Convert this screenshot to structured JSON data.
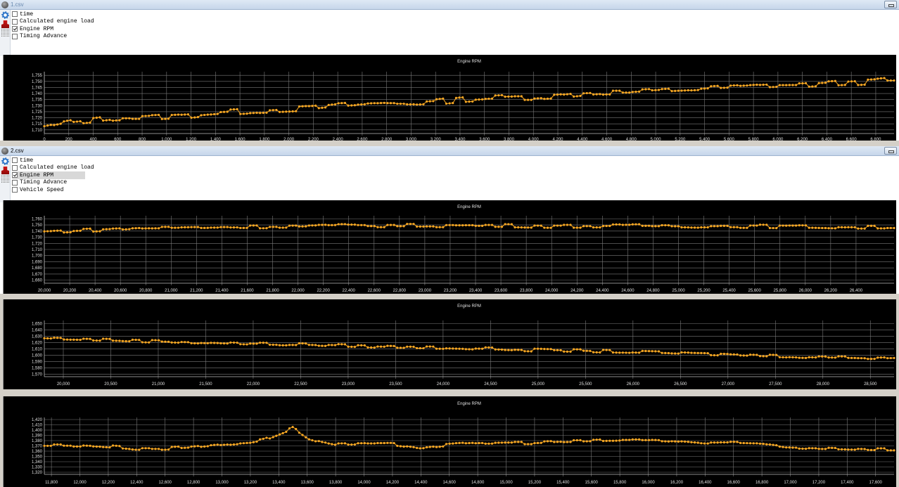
{
  "windows": [
    {
      "title": "1.csv",
      "fields": [
        {
          "label": "time",
          "checked": false
        },
        {
          "label": "Calculated engine load",
          "checked": false
        },
        {
          "label": "Engine RPM",
          "checked": true
        },
        {
          "label": "Timing Advance",
          "checked": false
        }
      ],
      "icons": [
        "gear-icon",
        "stamp-icon",
        "barcode-icon"
      ]
    },
    {
      "title": "2.csv",
      "fields": [
        {
          "label": "time",
          "checked": false
        },
        {
          "label": "Calculated engine load",
          "checked": false
        },
        {
          "label": "Engine RPM",
          "checked": true
        },
        {
          "label": "Timing Advance",
          "checked": false
        },
        {
          "label": "Vehicle Speed",
          "checked": false
        }
      ],
      "icons": [
        "gear-icon",
        "stamp-icon",
        "barcode-icon"
      ]
    }
  ],
  "colors": {
    "series": "#f5a623",
    "background": "#000000",
    "grid": "#7a7a7a",
    "text": "#e0e0e0"
  },
  "chart_data": [
    {
      "type": "line",
      "title": "Engine RPM",
      "xlim": [
        0,
        6950
      ],
      "ylim": [
        1707,
        1758
      ],
      "xticks": [
        0,
        200,
        400,
        600,
        800,
        1000,
        1200,
        1400,
        1600,
        1800,
        2000,
        2200,
        2400,
        2600,
        2800,
        3000,
        3200,
        3400,
        3600,
        3800,
        4000,
        4200,
        4400,
        4600,
        4800,
        5000,
        5200,
        5400,
        5600,
        5800,
        6000,
        6200,
        6400,
        6600,
        6800
      ],
      "xtick_labels": [
        "0",
        "200",
        "400",
        "600",
        "800",
        "1,000",
        "1,200",
        "1,400",
        "1,600",
        "1,800",
        "2,000",
        "2,200",
        "2,400",
        "2,600",
        "2,800",
        "3,000",
        "3,200",
        "3,400",
        "3,600",
        "3,800",
        "4,000",
        "4,200",
        "4,400",
        "4,600",
        "4,800",
        "5,000",
        "5,200",
        "5,400",
        "5,600",
        "5,800",
        "6,000",
        "6,200",
        "6,400",
        "6,600",
        "6,800"
      ],
      "yticks": [
        1710,
        1715,
        1720,
        1725,
        1730,
        1735,
        1740,
        1745,
        1750,
        1755
      ],
      "ytick_labels": [
        "1,710",
        "1,715",
        "1,720",
        "1,725",
        "1,730",
        "1,735",
        "1,740",
        "1,745",
        "1,750",
        "1,755"
      ],
      "series": [
        {
          "name": "Engine RPM",
          "x": [
            0,
            200,
            400,
            600,
            800,
            1000,
            1200,
            1400,
            1600,
            1800,
            2000,
            2200,
            2400,
            2600,
            2800,
            3000,
            3200,
            3400,
            3600,
            3800,
            4000,
            4200,
            4400,
            4600,
            4800,
            5000,
            5200,
            5400,
            5600,
            5800,
            6000,
            6200,
            6400,
            6600,
            6800,
            6900
          ],
          "y": [
            1712,
            1716,
            1718,
            1720,
            1720,
            1721,
            1722,
            1724,
            1725,
            1726,
            1727,
            1728,
            1730,
            1731,
            1732,
            1732,
            1733,
            1735,
            1736,
            1737,
            1737,
            1738,
            1740,
            1741,
            1741,
            1742,
            1743,
            1744,
            1745,
            1746,
            1747,
            1747,
            1748,
            1749,
            1750,
            1751
          ]
        }
      ]
    },
    {
      "type": "line",
      "title": "Engine RPM",
      "xlim": [
        20000,
        26700
      ],
      "ylim": [
        1655,
        1765
      ],
      "xticks": [
        20000,
        20200,
        20400,
        20600,
        20800,
        21000,
        21200,
        21400,
        21600,
        21800,
        22000,
        22200,
        22400,
        22600,
        22800,
        23000,
        23200,
        23400,
        23600,
        23800,
        24000,
        24200,
        24400,
        24600,
        24800,
        25000,
        25200,
        25400,
        25600,
        25800,
        26000,
        26200,
        26400
      ],
      "xtick_labels": [
        "20,000",
        "20,200",
        "20,400",
        "20,600",
        "20,800",
        "21,000",
        "21,200",
        "21,400",
        "21,600",
        "21,800",
        "22,000",
        "22,200",
        "22,400",
        "22,600",
        "22,800",
        "23,000",
        "23,200",
        "23,400",
        "23,600",
        "23,800",
        "24,000",
        "24,200",
        "24,400",
        "24,600",
        "24,800",
        "25,000",
        "25,200",
        "25,400",
        "25,600",
        "25,800",
        "26,000",
        "26,200",
        "26,400"
      ],
      "yticks": [
        1660,
        1670,
        1680,
        1690,
        1700,
        1710,
        1720,
        1730,
        1740,
        1750,
        1760
      ],
      "ytick_labels": [
        "1,660",
        "1,670",
        "1,680",
        "1,690",
        "1,700",
        "1,710",
        "1,720",
        "1,730",
        "1,740",
        "1,750",
        "1,760"
      ],
      "series": [
        {
          "name": "Engine RPM",
          "x": [
            20000,
            20400,
            20800,
            21200,
            21600,
            22000,
            22400,
            22800,
            23200,
            23600,
            24000,
            24400,
            24800,
            25200,
            25600,
            26000,
            26400,
            26700
          ],
          "y": [
            1739,
            1742,
            1745,
            1746,
            1747,
            1748,
            1749,
            1749,
            1749,
            1749,
            1748,
            1748,
            1749,
            1748,
            1748,
            1747,
            1746,
            1746
          ]
        }
      ]
    },
    {
      "type": "line",
      "title": "Engine RPM",
      "xlim": [
        19800,
        28750
      ],
      "ylim": [
        1566,
        1655
      ],
      "xticks": [
        20000,
        20500,
        21000,
        21500,
        22000,
        22500,
        23000,
        23500,
        24000,
        24500,
        25000,
        25500,
        26000,
        26500,
        27000,
        27500,
        28000,
        28500
      ],
      "xtick_labels": [
        "20,000",
        "20,500",
        "21,000",
        "21,500",
        "22,000",
        "22,500",
        "23,000",
        "23,500",
        "24,000",
        "24,500",
        "25,000",
        "25,500",
        "26,000",
        "26,500",
        "27,000",
        "27,500",
        "28,000",
        "28,500"
      ],
      "yticks": [
        1570,
        1580,
        1590,
        1600,
        1610,
        1620,
        1630,
        1640,
        1650
      ],
      "ytick_labels": [
        "1,570",
        "1,580",
        "1,590",
        "1,600",
        "1,610",
        "1,620",
        "1,630",
        "1,640",
        "1,650"
      ],
      "series": [
        {
          "name": "Engine RPM",
          "x": [
            19800,
            20500,
            21000,
            21500,
            22000,
            22500,
            23000,
            23500,
            24000,
            24500,
            25000,
            25500,
            26000,
            26500,
            27000,
            27500,
            28000,
            28500,
            28750
          ],
          "y": [
            1627,
            1624,
            1622,
            1620,
            1618,
            1617,
            1615,
            1613,
            1612,
            1610,
            1608,
            1607,
            1605,
            1603,
            1601,
            1599,
            1597,
            1596,
            1597
          ]
        }
      ]
    },
    {
      "type": "line",
      "title": "Engine RPM",
      "xlim": [
        11750,
        17730
      ],
      "ylim": [
        1316,
        1424
      ],
      "xticks": [
        11800,
        12000,
        12200,
        12400,
        12600,
        12800,
        13000,
        13200,
        13400,
        13600,
        13800,
        14000,
        14200,
        14400,
        14600,
        14800,
        15000,
        15200,
        15400,
        15600,
        15800,
        16000,
        16200,
        16400,
        16600,
        16800,
        17000,
        17200,
        17400,
        17600
      ],
      "xtick_labels": [
        "11,800",
        "12,000",
        "12,200",
        "12,400",
        "12,600",
        "12,800",
        "13,000",
        "13,200",
        "13,400",
        "13,600",
        "13,800",
        "14,000",
        "14,200",
        "14,400",
        "14,600",
        "14,800",
        "15,000",
        "15,200",
        "15,400",
        "15,600",
        "15,800",
        "16,000",
        "16,200",
        "16,400",
        "16,600",
        "16,800",
        "17,000",
        "17,200",
        "17,400",
        "17,600"
      ],
      "yticks": [
        1320,
        1330,
        1340,
        1350,
        1360,
        1370,
        1380,
        1390,
        1400,
        1410,
        1420
      ],
      "ytick_labels": [
        "1,320",
        "1,330",
        "1,340",
        "1,350",
        "1,360",
        "1,370",
        "1,380",
        "1,390",
        "1,400",
        "1,410",
        "1,420"
      ],
      "series": [
        {
          "name": "Engine RPM",
          "x": [
            11750,
            12000,
            12200,
            12400,
            12600,
            12800,
            13000,
            13200,
            13300,
            13400,
            13500,
            13600,
            13700,
            13800,
            14000,
            14200,
            14400,
            14600,
            14800,
            15000,
            15200,
            15400,
            15600,
            15800,
            16000,
            16200,
            16400,
            16600,
            16800,
            17000,
            17200,
            17400,
            17600,
            17730
          ],
          "y": [
            1371,
            1371,
            1369,
            1365,
            1365,
            1368,
            1373,
            1377,
            1382,
            1393,
            1404,
            1385,
            1377,
            1372,
            1373,
            1373,
            1367,
            1372,
            1375,
            1376,
            1376,
            1378,
            1379,
            1381,
            1381,
            1379,
            1375,
            1375,
            1374,
            1367,
            1366,
            1365,
            1364,
            1364
          ]
        }
      ]
    }
  ]
}
